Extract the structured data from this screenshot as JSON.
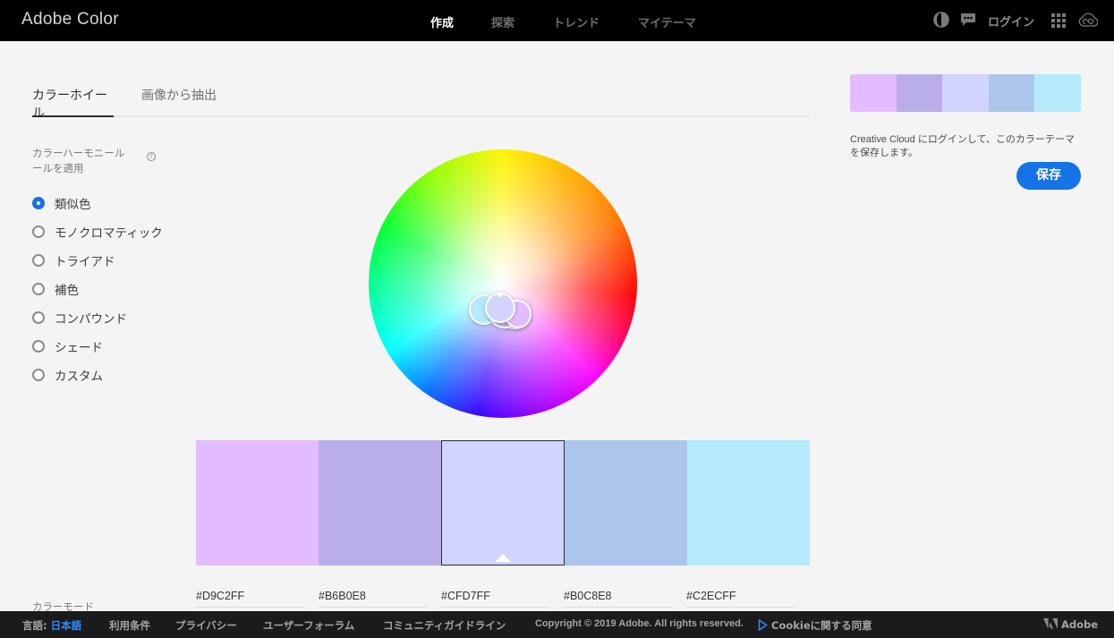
{
  "header": {
    "brand": "Adobe Color",
    "nav": [
      {
        "label": "作成",
        "active": true
      },
      {
        "label": "探索",
        "active": false
      },
      {
        "label": "トレンド",
        "active": false
      },
      {
        "label": "マイテーマ",
        "active": false
      }
    ],
    "login_label": "ログイン",
    "icons": [
      "contrast-icon",
      "feedback-icon",
      "apps-grid-icon",
      "creative-cloud-icon"
    ]
  },
  "tabs": [
    {
      "label": "カラーホイール",
      "active": true
    },
    {
      "label": "画像から抽出",
      "active": false
    }
  ],
  "harmony": {
    "label": "カラーハーモニールールを適用",
    "label_line1": "カラーハーモニール",
    "label_line2": "ールを適用",
    "help_glyph": "?",
    "options": [
      {
        "label": "類似色",
        "checked": true
      },
      {
        "label": "モノクロマティック",
        "checked": false
      },
      {
        "label": "トライアド",
        "checked": false
      },
      {
        "label": "補色",
        "checked": false
      },
      {
        "label": "コンパウンド",
        "checked": false
      },
      {
        "label": "シェード",
        "checked": false
      },
      {
        "label": "カスタム",
        "checked": false
      }
    ]
  },
  "swatches": [
    {
      "hex": "#D9C2FF",
      "color": "#e2bcff",
      "selected": false
    },
    {
      "hex": "#B6B0E8",
      "color": "#b9aeea",
      "selected": false
    },
    {
      "hex": "#CFD7FF",
      "color": "#d0d4ff",
      "selected": true
    },
    {
      "hex": "#B0C8E8",
      "color": "#abc6ea",
      "selected": false
    },
    {
      "hex": "#C2ECFF",
      "color": "#b5eafd",
      "selected": false
    }
  ],
  "color_mode_label": "カラーモード",
  "right_panel": {
    "note": "Creative Cloud にログインして、このカラーテーマを保存します。",
    "save_label": "保存"
  },
  "footer": {
    "language_prefix": "言語:",
    "language_value": "日本語",
    "links": [
      "利用条件",
      "プライバシー",
      "ユーザーフォーラム",
      "コミュニティガイドライン"
    ],
    "copyright": "Copyright © 2019 Adobe. All rights reserved.",
    "cookie_label": "Cookieに関する同意",
    "adobe_label": "Adobe"
  },
  "colors": {
    "accent": "#1473e6",
    "topbar_bg": "#000000",
    "footer_bg": "#1b1b1b",
    "page_bg": "#f4f4f4"
  }
}
